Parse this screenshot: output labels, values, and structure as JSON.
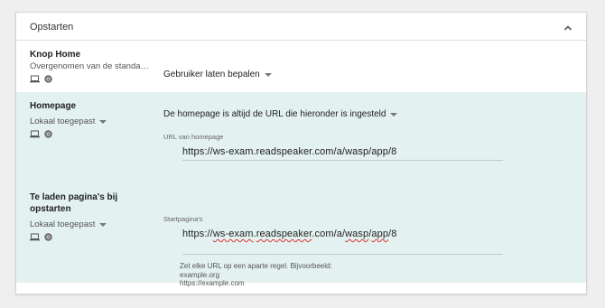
{
  "section": {
    "title": "Opstarten",
    "collapse_icon": "chevron-up-icon"
  },
  "rows": {
    "home_button": {
      "name": "Knop Home",
      "sub": "Overgenomen van de standaar...",
      "control_value": "Gebruiker laten bepalen"
    },
    "homepage": {
      "name": "Homepage",
      "sub": "Lokaal toegepast",
      "control_value": "De homepage is altijd de URL die hieronder is ingesteld",
      "field_label": "URL van homepage",
      "field_value": "https://ws-exam.readspeaker.com/a/wasp/app/8"
    },
    "startup_pages": {
      "name_line1": "Te laden pagina's bij",
      "name_line2": "opstarten",
      "sub": "Lokaal toegepast",
      "field_label": "Startpagina's",
      "url_parts": [
        "https://",
        "ws-exam",
        ".",
        "readspeaker",
        ".com/a/",
        "wasp",
        "/",
        "app",
        "/8"
      ],
      "hint_line1": "Zet elke URL op een aparte regel. Bijvoorbeeld:",
      "hint_line2": "example.org",
      "hint_line3": "https://example.com"
    }
  },
  "icons": {
    "platform": "laptop-icon",
    "browser": "chrome-icon"
  },
  "colors": {
    "shaded_row": "#e3f1f0",
    "page_background": "#efefef"
  }
}
